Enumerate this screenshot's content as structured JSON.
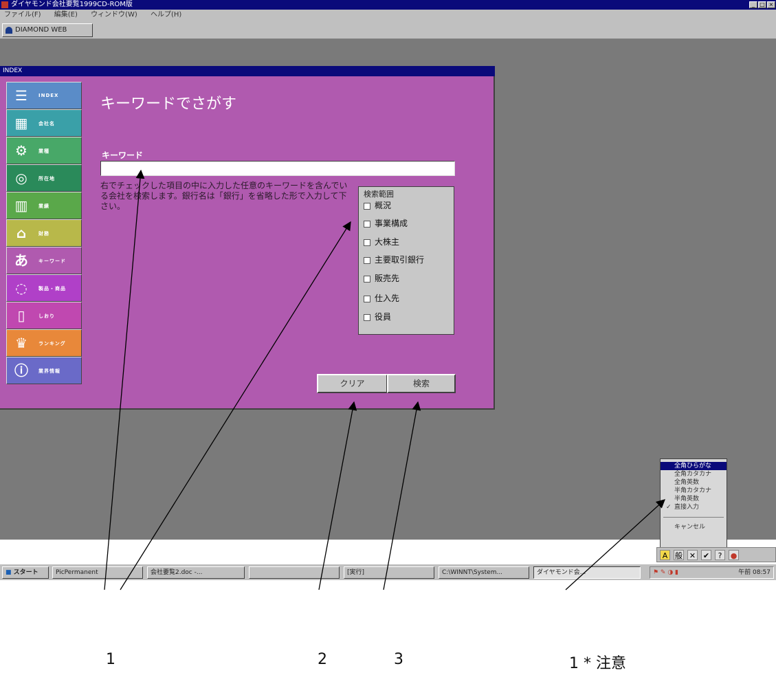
{
  "window": {
    "title": "ダイヤモンド会社要覧1999CD-ROM版"
  },
  "menu": [
    "ファイル(F)",
    "編集(E)",
    "ウィンドウ(W)",
    "ヘルプ(H)"
  ],
  "toolbar": {
    "diamond_label": "DIAMOND WEB"
  },
  "index_window": {
    "title": "INDEX",
    "sidebar": [
      {
        "label": "INDEX",
        "color": "#5a8cc8"
      },
      {
        "label": "会社名",
        "color": "#3aa0a8"
      },
      {
        "label": "業種",
        "color": "#48a868"
      },
      {
        "label": "所在地",
        "color": "#2a8a5a"
      },
      {
        "label": "業績",
        "color": "#5aa84a"
      },
      {
        "label": "財務",
        "color": "#b8b84a"
      },
      {
        "label": "キーワード",
        "color": "#b05aaf"
      },
      {
        "label": "製品・商品",
        "color": "#b040c8"
      },
      {
        "label": "しおり",
        "color": "#c048b0"
      },
      {
        "label": "ランキング",
        "color": "#e8883a"
      },
      {
        "label": "業界情報",
        "color": "#6a6ac8"
      }
    ],
    "heading": "キーワードでさがす",
    "keyword_label": "キーワード",
    "keyword_value": "",
    "description": "右でチェックした項目の中に入力した任意のキーワードを含んでいる会社を検索します。銀行名は「銀行」を省略した形で入力して下さい。",
    "range_legend": "検索範囲",
    "checkboxes": [
      "概況",
      "事業構成",
      "大株主",
      "主要取引銀行",
      "販売先",
      "仕入先",
      "役員"
    ],
    "clear_label": "クリア",
    "search_label": "検索"
  },
  "ime_menu": {
    "items": [
      "全角ひらがな",
      "全角カタカナ",
      "全角英数",
      "半角カタカナ",
      "半角英数",
      "直接入力"
    ],
    "selected": "全角ひらがな",
    "checked": "直接入力",
    "cancel_label": "キャンセル",
    "toolbar_icons": [
      "A",
      "般",
      "✕",
      "✔",
      "?",
      "●"
    ]
  },
  "taskbar": {
    "start_label": "スタート",
    "tasks": [
      "PicPermanent",
      "会社要覧2.doc -...",
      "",
      "[実行]",
      "C:\\WINNT\\System...",
      "ダイヤモンド会..."
    ],
    "active_task": "ダイヤモンド会...",
    "clock": "午前 08:57"
  },
  "annotations": [
    "1",
    "2",
    "3",
    "1 * 注意"
  ]
}
